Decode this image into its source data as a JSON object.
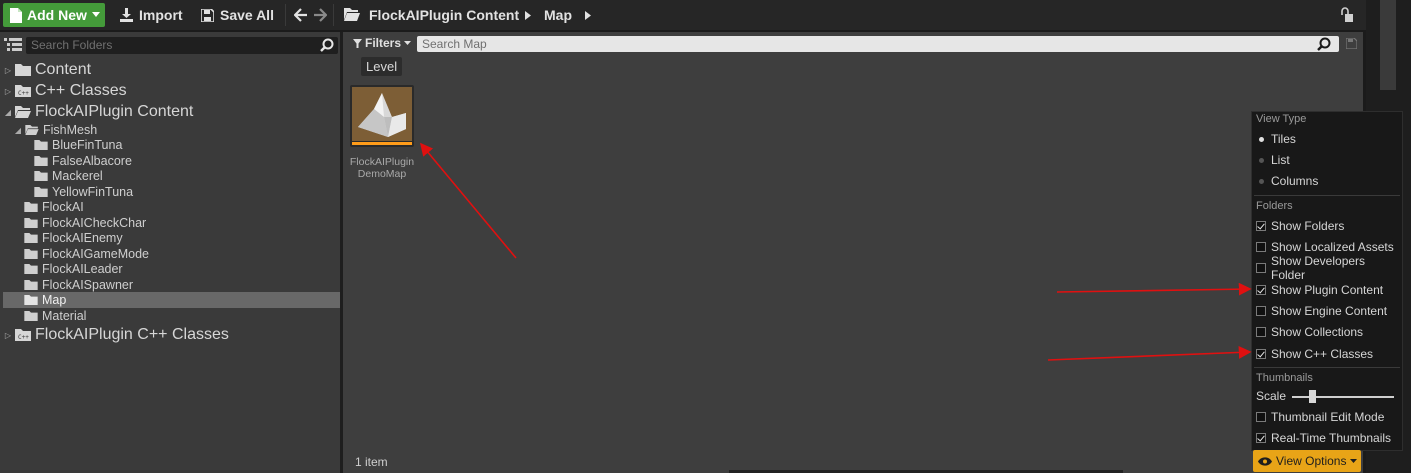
{
  "toolbar": {
    "add_new": "Add New",
    "import": "Import",
    "save_all": "Save All",
    "path": [
      "FlockAIPlugin Content",
      "Map"
    ]
  },
  "left_panel": {
    "search_placeholder": "Search Folders",
    "tree": [
      {
        "label": "Content",
        "level": 0,
        "kind": "folder",
        "expandable": true
      },
      {
        "label": "C++ Classes",
        "level": 0,
        "kind": "code-folder",
        "expandable": true
      },
      {
        "label": "FlockAIPlugin Content",
        "level": 0,
        "kind": "folder",
        "expanded": true
      },
      {
        "label": "FishMesh",
        "level": 1,
        "kind": "folder",
        "expanded": true
      },
      {
        "label": "BlueFinTuna",
        "level": 2,
        "kind": "folder"
      },
      {
        "label": "FalseAlbacore",
        "level": 2,
        "kind": "folder"
      },
      {
        "label": "Mackerel",
        "level": 2,
        "kind": "folder"
      },
      {
        "label": "YellowFinTuna",
        "level": 2,
        "kind": "folder"
      },
      {
        "label": "FlockAI",
        "level": 1,
        "kind": "folder"
      },
      {
        "label": "FlockAICheckChar",
        "level": 1,
        "kind": "folder"
      },
      {
        "label": "FlockAIEnemy",
        "level": 1,
        "kind": "folder"
      },
      {
        "label": "FlockAIGameMode",
        "level": 1,
        "kind": "folder"
      },
      {
        "label": "FlockAILeader",
        "level": 1,
        "kind": "folder"
      },
      {
        "label": "FlockAISpawner",
        "level": 1,
        "kind": "folder"
      },
      {
        "label": "Map",
        "level": 1,
        "kind": "folder",
        "selected": true
      },
      {
        "label": "Material",
        "level": 1,
        "kind": "folder"
      },
      {
        "label": "FlockAIPlugin C++ Classes",
        "level": 0,
        "kind": "code-folder",
        "expandable": true
      }
    ]
  },
  "main": {
    "filters_label": "Filters",
    "search_placeholder": "Search Map",
    "filter_chip": "Level",
    "asset": {
      "name_line1": "FlockAIPlugin",
      "name_line2": "DemoMap",
      "type_color": "#ff9c1a"
    },
    "status": "1 item"
  },
  "view_options": {
    "button_label": "View Options",
    "view_type_header": "View Type",
    "view_types": [
      {
        "label": "Tiles",
        "selected": true
      },
      {
        "label": "List",
        "selected": false
      },
      {
        "label": "Columns",
        "selected": false
      }
    ],
    "folders_header": "Folders",
    "folder_options": [
      {
        "label": "Show Folders",
        "checked": true
      },
      {
        "label": "Show Localized Assets",
        "checked": false
      },
      {
        "label": "Show Developers Folder",
        "checked": false
      },
      {
        "label": "Show Plugin Content",
        "checked": true
      },
      {
        "label": "Show Engine Content",
        "checked": false
      },
      {
        "label": "Show Collections",
        "checked": false
      },
      {
        "label": "Show C++ Classes",
        "checked": true
      }
    ],
    "thumbnails_header": "Thumbnails",
    "scale_label": "Scale",
    "scale_value": 0.2,
    "thumbnail_options": [
      {
        "label": "Thumbnail Edit Mode",
        "checked": false
      },
      {
        "label": "Real-Time Thumbnails",
        "checked": true
      }
    ]
  },
  "colors": {
    "accent_green": "#449b3a",
    "accent_orange": "#e8a417",
    "annotation_red": "#e01010"
  }
}
